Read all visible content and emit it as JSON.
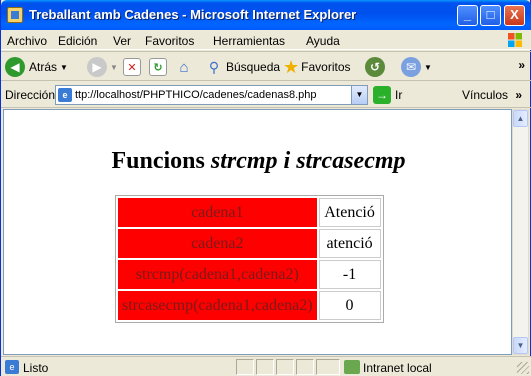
{
  "window": {
    "title": "Treballant amb Cadenes - Microsoft Internet Explorer",
    "minimize": "_",
    "maximize": "□",
    "close": "X"
  },
  "menu": {
    "items": [
      "Archivo",
      "Edición",
      "Ver",
      "Favoritos",
      "Herramientas",
      "Ayuda"
    ]
  },
  "toolbar": {
    "back_label": "Atrás",
    "search_label": "Búsqueda",
    "favorites_label": "Favoritos",
    "overflow": "»"
  },
  "address": {
    "label": "Dirección",
    "url": "ttp://localhost/PHPTHICO/cadenes/cadenas8.php",
    "go_label": "Ir",
    "links_label": "Vínculos",
    "links_overflow": "»"
  },
  "page": {
    "title_plain": "Funcions ",
    "title_italic": "strcmp i strcasecmp",
    "rows": [
      {
        "label": "cadena1",
        "value": "Atenció"
      },
      {
        "label": "cadena2",
        "value": "atenció"
      },
      {
        "label": "strcmp(cadena1,cadena2)",
        "value": "-1"
      },
      {
        "label": "strcasecmp(cadena1,cadena2)",
        "value": "0"
      }
    ]
  },
  "status": {
    "text": "Listo",
    "zone": "Intranet local"
  },
  "colors": {
    "label_cell_bg": "#ff0000",
    "label_cell_text": "#7a1a1a",
    "titlebar": "#0053ee"
  }
}
